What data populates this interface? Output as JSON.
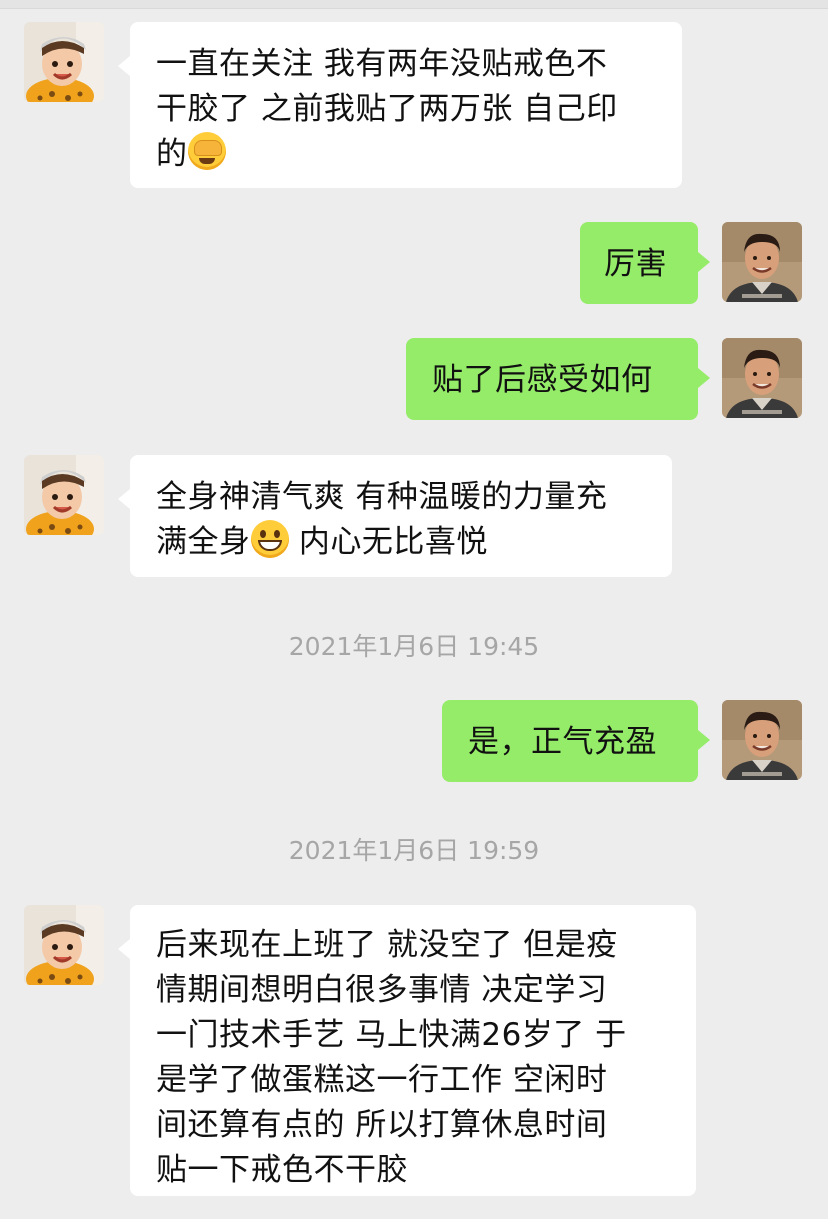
{
  "conversation": {
    "messages": [
      {
        "sender": "other",
        "avatar": "child-avatar",
        "lines": [
          "一直在关注 我有两年没贴戒色不",
          "干胶了 之前我贴了两万张 自己印",
          "的"
        ],
        "emoji": "facepalm-emoji"
      },
      {
        "sender": "self",
        "avatar": "man-avatar",
        "lines": [
          "厉害"
        ]
      },
      {
        "sender": "self",
        "avatar": "man-avatar",
        "lines": [
          "贴了后感受如何"
        ]
      },
      {
        "sender": "other",
        "avatar": "child-avatar",
        "lines": [
          "全身神清气爽 有种温暖的力量充",
          "满全身",
          " 内心无比喜悦"
        ],
        "emoji": "grinning-emoji"
      },
      {
        "sender": "self",
        "avatar": "man-avatar",
        "lines": [
          "是，正气充盈"
        ]
      },
      {
        "sender": "other",
        "avatar": "child-avatar",
        "lines": [
          "后来现在上班了 就没空了 但是疫",
          "情期间想明白很多事情 决定学习",
          "一门技术手艺 马上快满26岁了 于",
          "是学了做蛋糕这一行工作 空闲时",
          "间还算有点的 所以打算休息时间",
          "贴一下戒色不干胶"
        ]
      }
    ],
    "timestamps": [
      "2021年1月6日 19:45",
      "2021年1月6日 19:59"
    ]
  },
  "colors": {
    "background": "#ededed",
    "incoming_bubble": "#ffffff",
    "outgoing_bubble": "#95ec69",
    "timestamp_text": "#a6a6a6"
  }
}
